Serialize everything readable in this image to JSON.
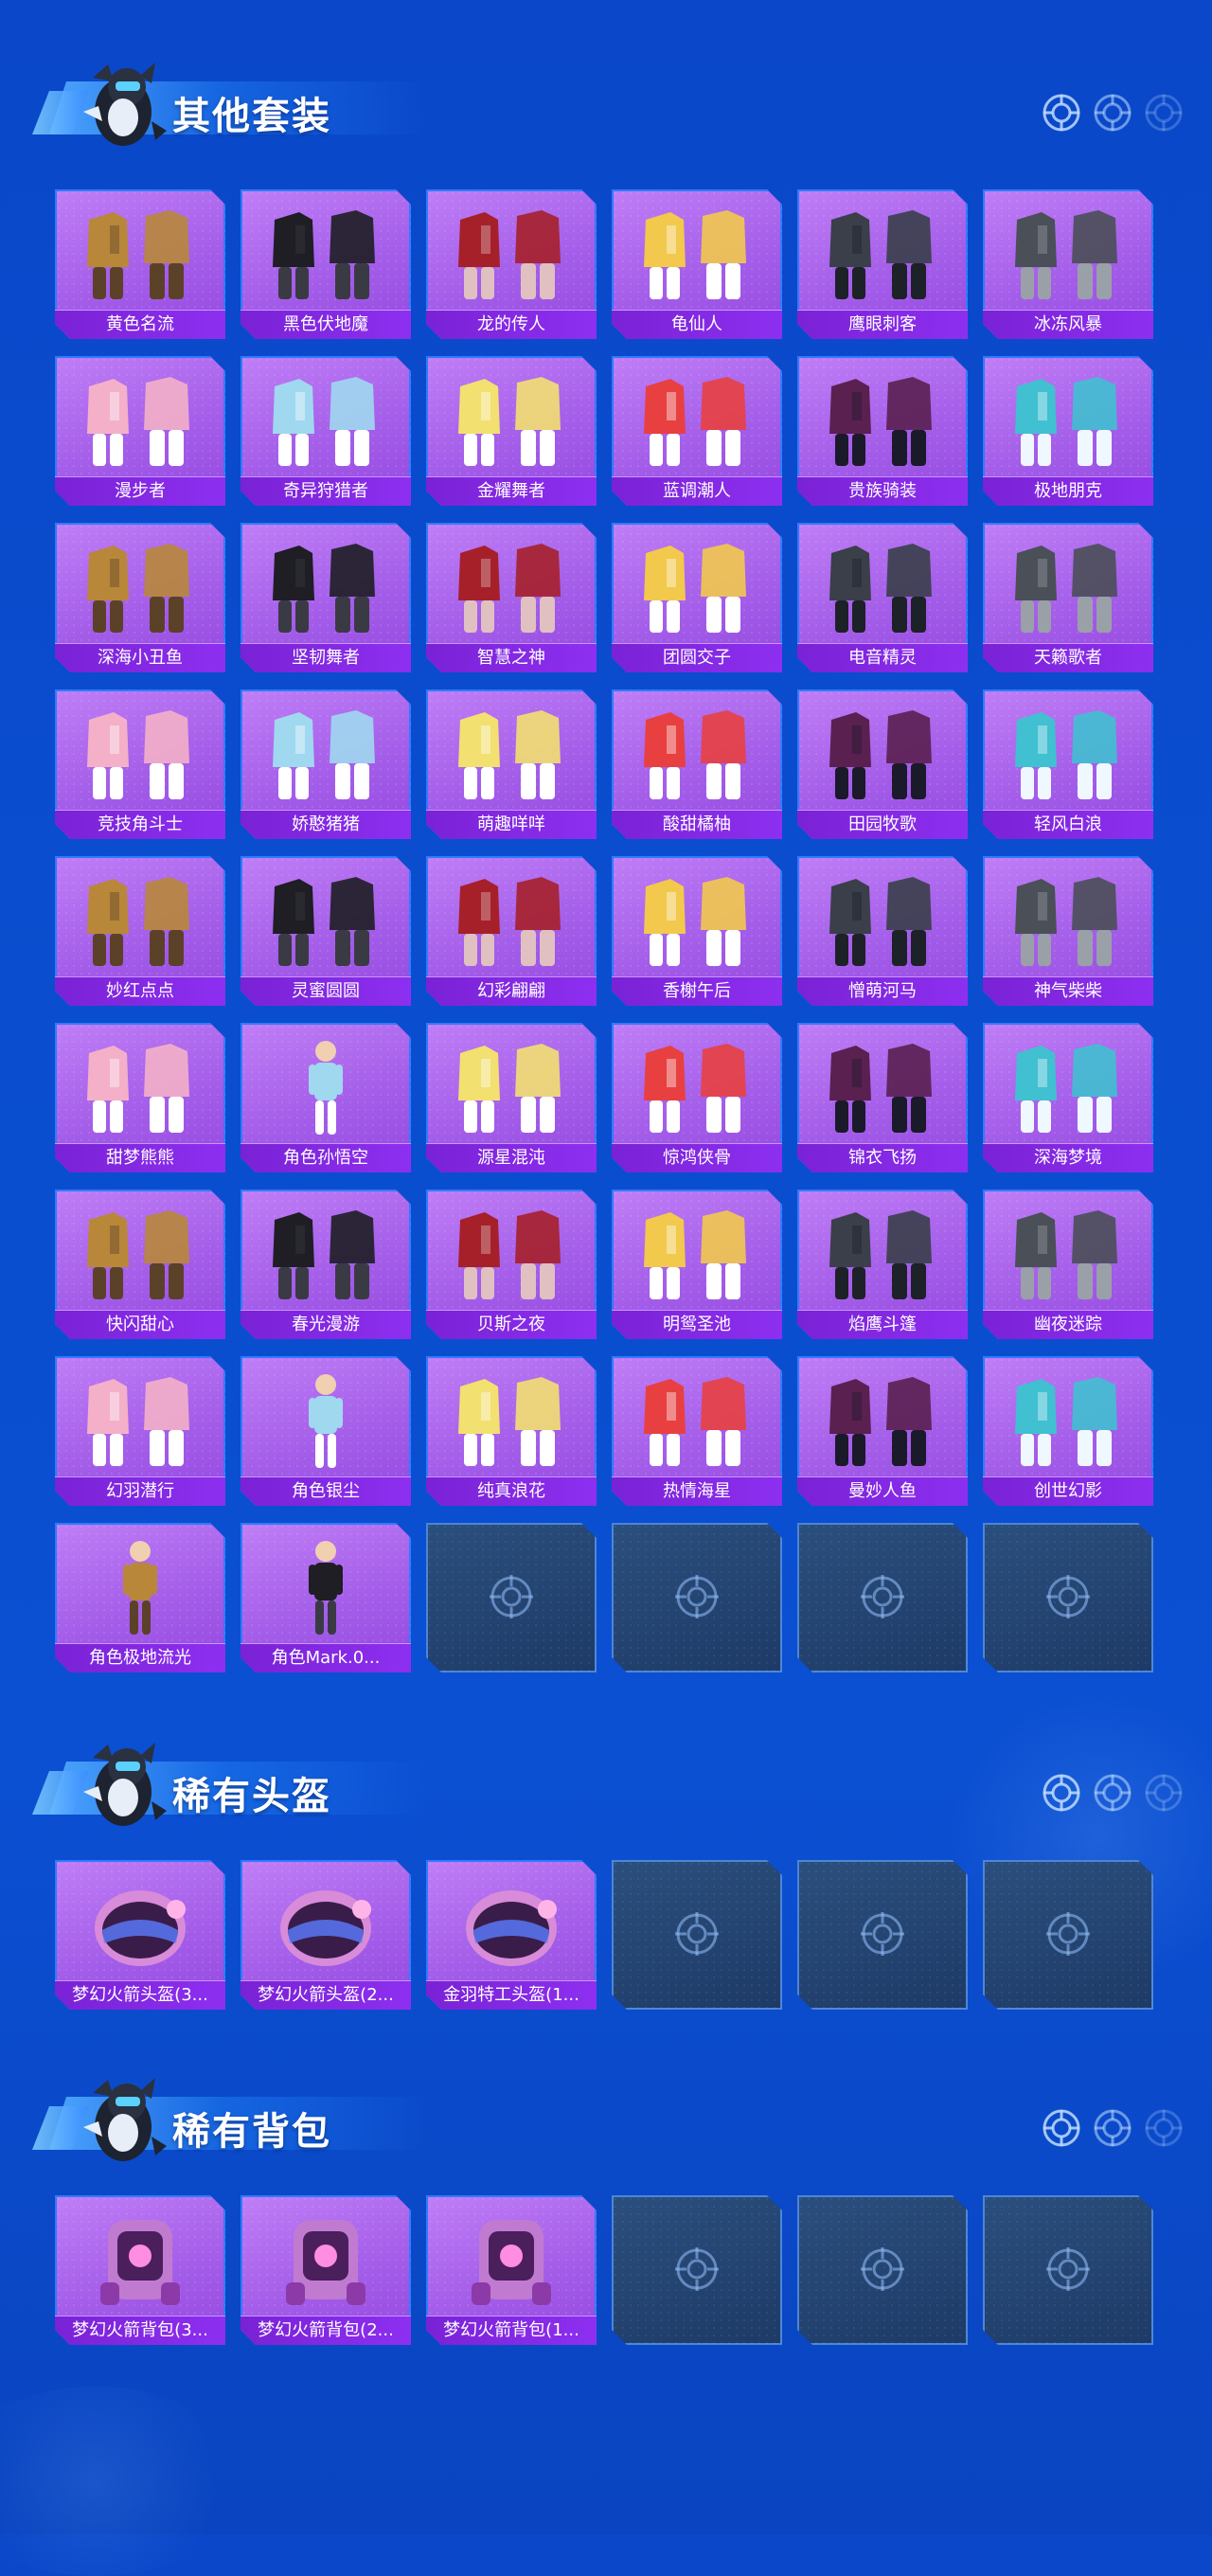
{
  "colors": {
    "accent_blue": "#0a4ecf",
    "card_purple": "#a45ee9",
    "label_purple": "#7a22d6",
    "empty_slot": "#1e3a66"
  },
  "sections": [
    {
      "title": "其他套装",
      "items": [
        {
          "name": "黄色名流",
          "icon": "outfit-icon"
        },
        {
          "name": "黑色伏地魔",
          "icon": "outfit-icon"
        },
        {
          "name": "龙的传人",
          "icon": "outfit-icon"
        },
        {
          "name": "龟仙人",
          "icon": "outfit-icon"
        },
        {
          "name": "鹰眼刺客",
          "icon": "outfit-icon"
        },
        {
          "name": "冰冻风暴",
          "icon": "outfit-icon"
        },
        {
          "name": "漫步者",
          "icon": "outfit-icon"
        },
        {
          "name": "奇异狩猎者",
          "icon": "outfit-icon"
        },
        {
          "name": "金耀舞者",
          "icon": "outfit-icon"
        },
        {
          "name": "蓝调潮人",
          "icon": "outfit-icon"
        },
        {
          "name": "贵族骑装",
          "icon": "outfit-icon"
        },
        {
          "name": "极地朋克",
          "icon": "outfit-icon"
        },
        {
          "name": "深海小丑鱼",
          "icon": "outfit-icon"
        },
        {
          "name": "坚韧舞者",
          "icon": "outfit-icon"
        },
        {
          "name": "智慧之神",
          "icon": "outfit-icon"
        },
        {
          "name": "团圆交子",
          "icon": "outfit-icon"
        },
        {
          "name": "电音精灵",
          "icon": "outfit-icon"
        },
        {
          "name": "天籁歌者",
          "icon": "outfit-icon"
        },
        {
          "name": "竞技角斗士",
          "icon": "outfit-icon"
        },
        {
          "name": "娇憨猪猪",
          "icon": "outfit-icon"
        },
        {
          "name": "萌趣咩咩",
          "icon": "outfit-icon"
        },
        {
          "name": "酸甜橘柚",
          "icon": "outfit-icon"
        },
        {
          "name": "田园牧歌",
          "icon": "outfit-icon"
        },
        {
          "name": "轻风白浪",
          "icon": "outfit-icon"
        },
        {
          "name": "妙红点点",
          "icon": "outfit-icon"
        },
        {
          "name": "灵蜜圆圆",
          "icon": "outfit-icon"
        },
        {
          "name": "幻彩翩翩",
          "icon": "outfit-icon"
        },
        {
          "name": "香榭午后",
          "icon": "outfit-icon"
        },
        {
          "name": "憎萌河马",
          "icon": "outfit-icon"
        },
        {
          "name": "神气柴柴",
          "icon": "outfit-icon"
        },
        {
          "name": "甜梦熊熊",
          "icon": "outfit-icon"
        },
        {
          "name": "角色孙悟空",
          "icon": "character-icon"
        },
        {
          "name": "源星混沌",
          "icon": "outfit-icon"
        },
        {
          "name": "惊鸿侠骨",
          "icon": "outfit-icon"
        },
        {
          "name": "锦衣飞扬",
          "icon": "outfit-icon"
        },
        {
          "name": "深海梦境",
          "icon": "outfit-icon"
        },
        {
          "name": "快闪甜心",
          "icon": "outfit-icon"
        },
        {
          "name": "春光漫游",
          "icon": "outfit-icon"
        },
        {
          "name": "贝斯之夜",
          "icon": "outfit-icon"
        },
        {
          "name": "明鸳圣池",
          "icon": "outfit-icon"
        },
        {
          "name": "焰鹰斗篷",
          "icon": "outfit-icon"
        },
        {
          "name": "幽夜迷踪",
          "icon": "outfit-icon"
        },
        {
          "name": "幻羽潜行",
          "icon": "outfit-icon"
        },
        {
          "name": "角色银尘",
          "icon": "character-icon"
        },
        {
          "name": "纯真浪花",
          "icon": "outfit-icon"
        },
        {
          "name": "热情海星",
          "icon": "outfit-icon"
        },
        {
          "name": "曼妙人鱼",
          "icon": "outfit-icon"
        },
        {
          "name": "创世幻影",
          "icon": "outfit-icon"
        },
        {
          "name": "角色极地流光",
          "icon": "character-icon"
        },
        {
          "name": "角色Mark.0...",
          "icon": "character-icon"
        }
      ],
      "empty_slots": 4
    },
    {
      "title": "稀有头盔",
      "items": [
        {
          "name": "梦幻火箭头盔(3...",
          "icon": "helmet-icon"
        },
        {
          "name": "梦幻火箭头盔(2...",
          "icon": "helmet-icon"
        },
        {
          "name": "金羽特工头盔(1...",
          "icon": "helmet-icon"
        }
      ],
      "empty_slots": 3
    },
    {
      "title": "稀有背包",
      "items": [
        {
          "name": "梦幻火箭背包(3...",
          "icon": "backpack-icon"
        },
        {
          "name": "梦幻火箭背包(2...",
          "icon": "backpack-icon"
        },
        {
          "name": "梦幻火箭背包(1...",
          "icon": "backpack-icon"
        }
      ],
      "empty_slots": 3
    }
  ]
}
